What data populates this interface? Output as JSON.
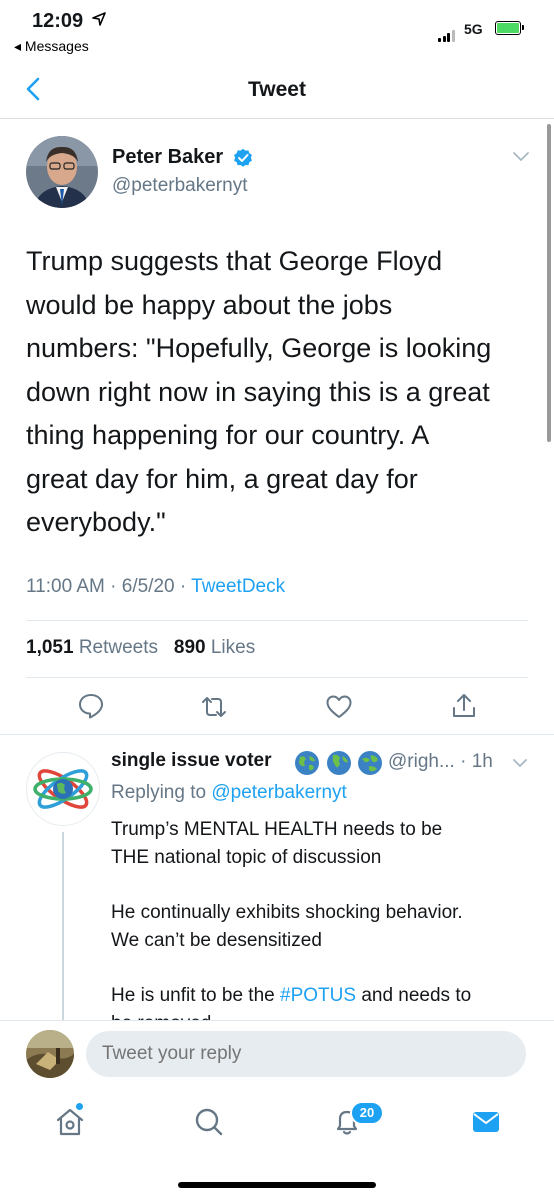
{
  "status_bar": {
    "time": "12:09",
    "back_app": "◂ Messages",
    "network": "5G"
  },
  "nav": {
    "title": "Tweet"
  },
  "tweet": {
    "author_name": "Peter Baker",
    "author_handle": "@peterbakernyt",
    "text_lines": [
      "Trump suggests that George Floyd",
      "would be happy about the jobs",
      "numbers: \"Hopefully, George is looking",
      "down right now in saying this is a great",
      "thing happening for our country. A",
      "great day for him, a great day for",
      "everybody.\""
    ],
    "time": "11:00 AM",
    "date": "6/5/20",
    "source": "TweetDeck",
    "retweets_count": "1,051",
    "retweets_label": "Retweets",
    "likes_count": "890",
    "likes_label": "Likes",
    "actions": [
      "reply-icon",
      "retweet-icon",
      "like-icon",
      "share-icon"
    ]
  },
  "reply": {
    "name": "single issue voter",
    "handle": "@righ...",
    "age": "1h",
    "replying_prefix": "Replying to",
    "replying_to": "@peterbakernyt",
    "line1": "Trump’s MENTAL HEALTH needs to be",
    "line2": "THE national topic of discussion",
    "line3": "He continually exhibits shocking behavior.",
    "line4": "We can’t be desensitized",
    "line5_a": "He is unfit to be the",
    "line5_tag": "#POTUS",
    "line5_b": "and needs to",
    "line6": "be removed"
  },
  "composer": {
    "placeholder": "Tweet your reply"
  },
  "tabbar": {
    "notifications_badge": "20",
    "items": [
      "home-icon",
      "search-icon",
      "notifications-icon",
      "messages-icon"
    ]
  },
  "colors": {
    "accent": "#1da1f2",
    "secondary_text": "#657786",
    "divider": "#e1e8ed"
  }
}
